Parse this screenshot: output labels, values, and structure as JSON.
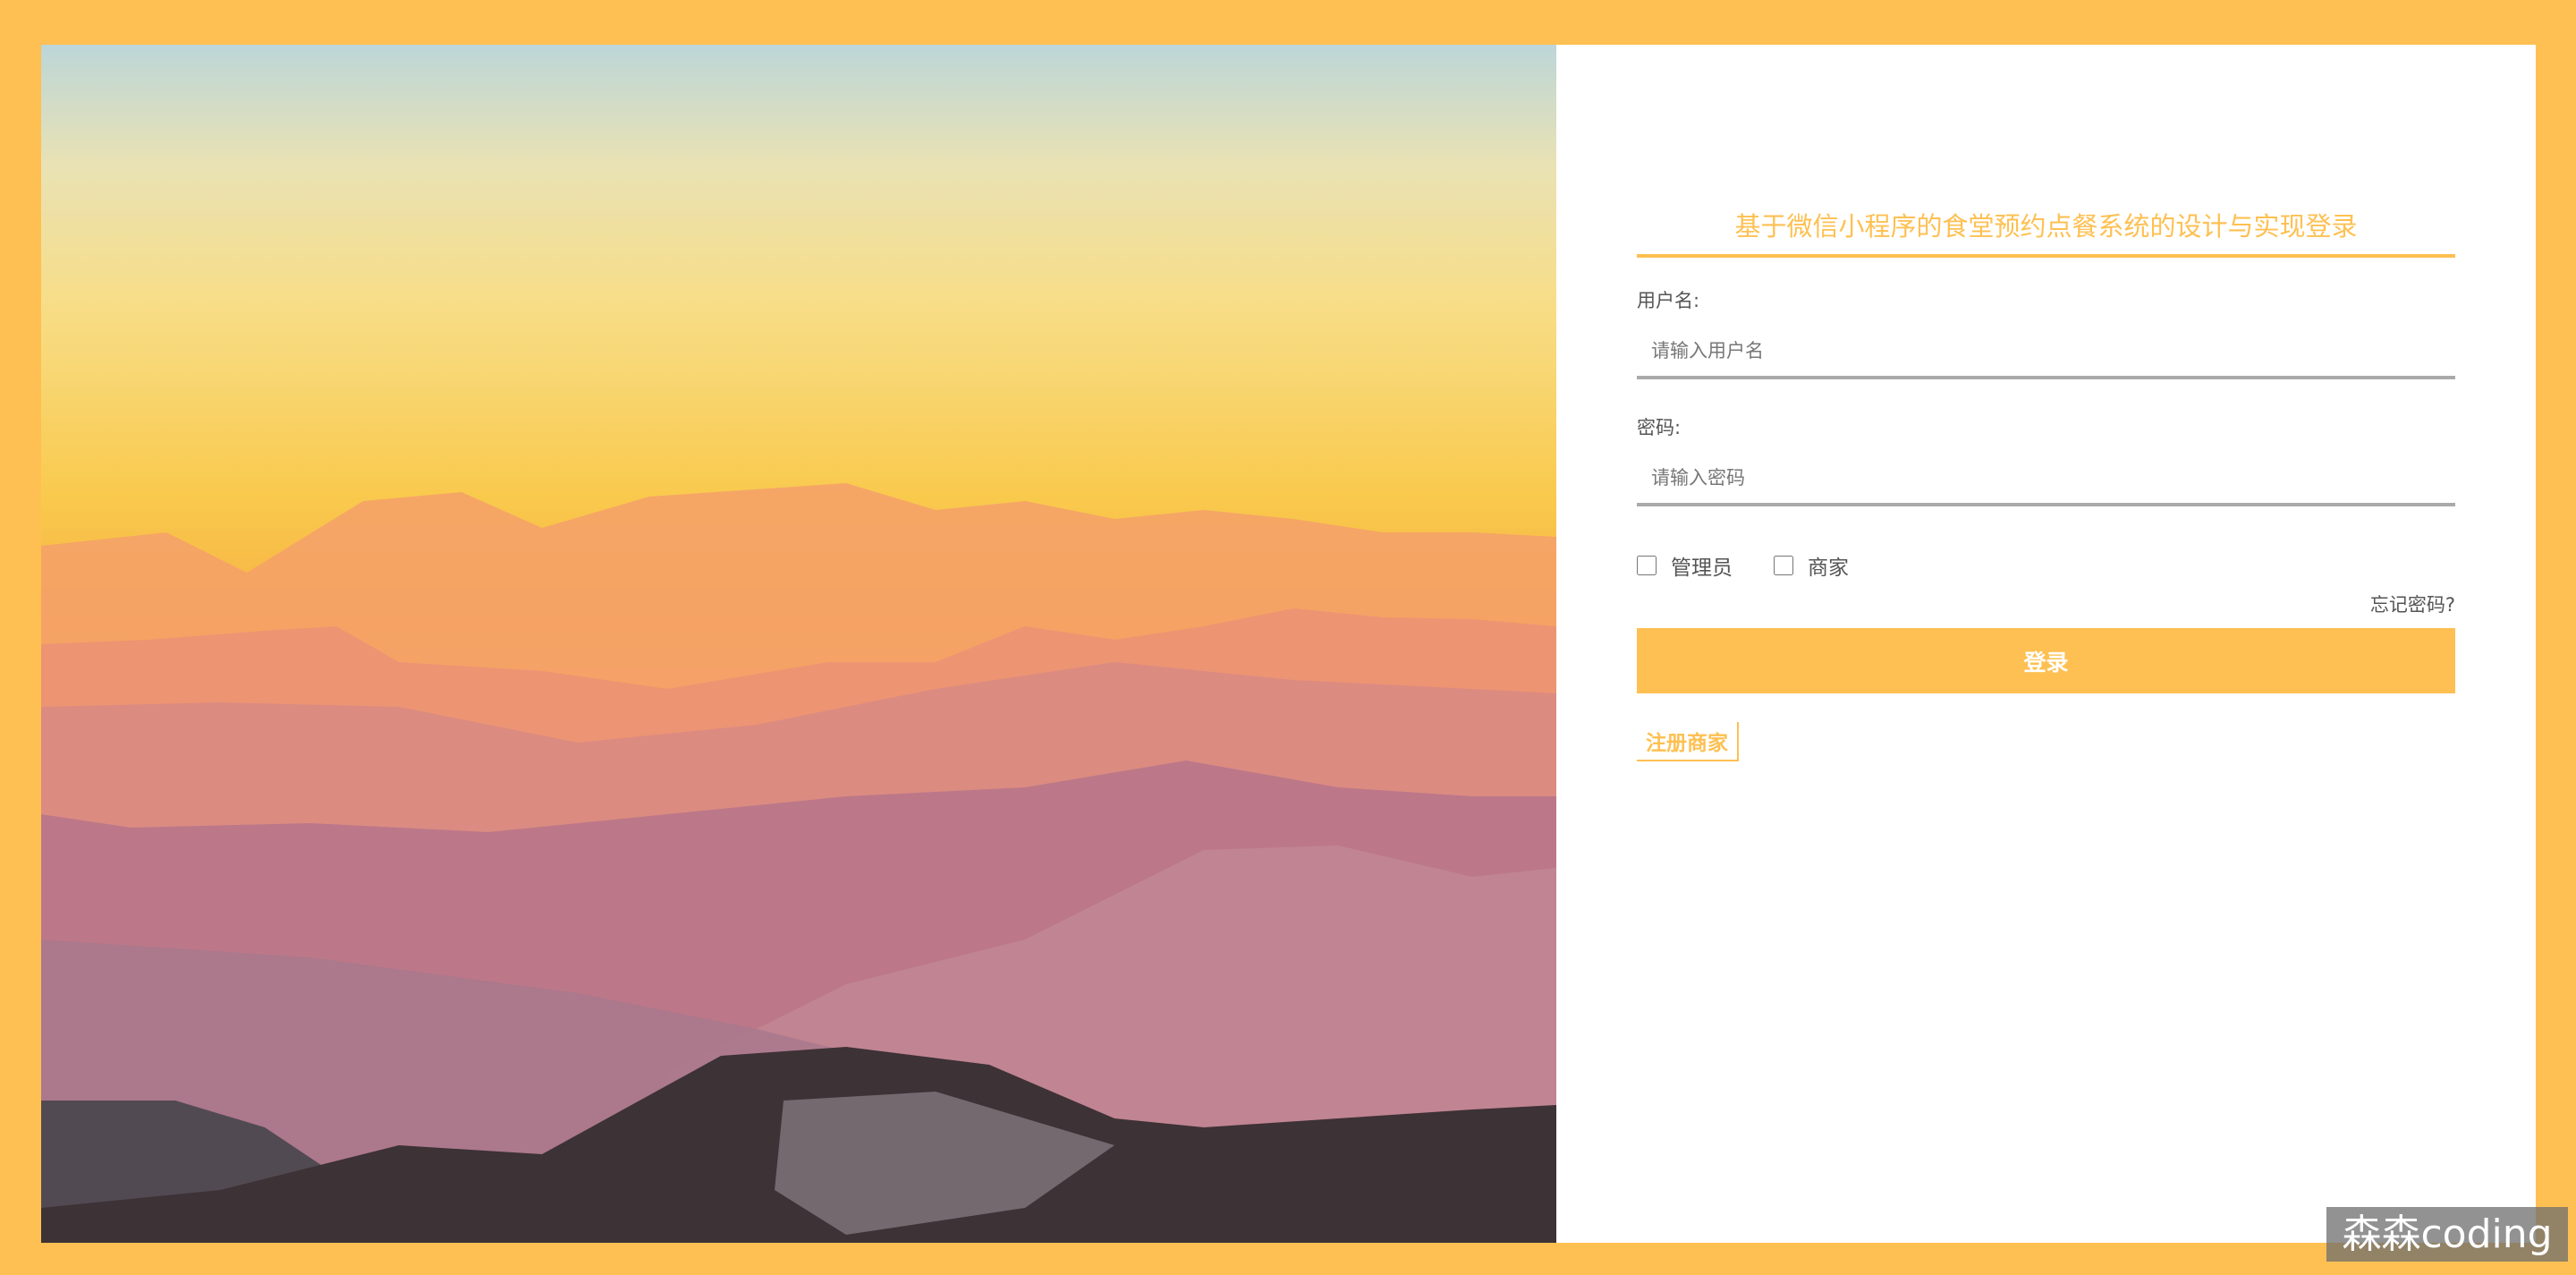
{
  "form": {
    "title": "基于微信小程序的食堂预约点餐系统的设计与实现登录",
    "username_label": "用户名:",
    "username_placeholder": "请输入用户名",
    "password_label": "密码:",
    "password_placeholder": "请输入密码",
    "roles": [
      {
        "label": "管理员",
        "checked": false
      },
      {
        "label": "商家",
        "checked": false
      }
    ],
    "forgot_label": "忘记密码?",
    "login_label": "登录",
    "register_label": "注册商家"
  },
  "watermark": "森森coding",
  "colors": {
    "accent": "#fec052",
    "frame": "#fec052"
  }
}
